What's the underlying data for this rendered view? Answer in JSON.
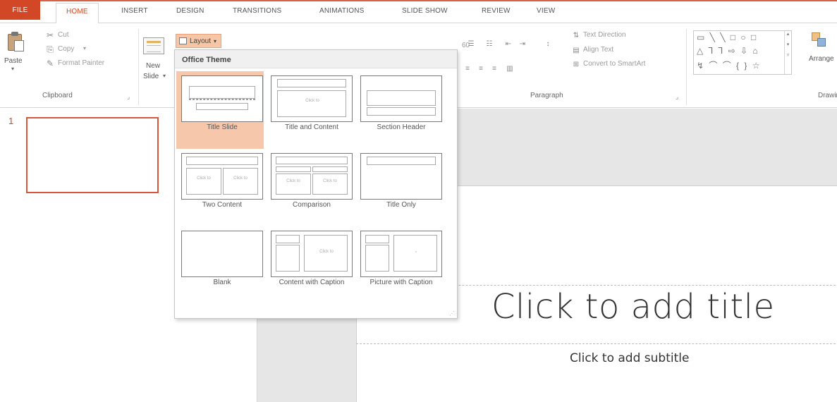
{
  "tabs": [
    {
      "label": "FILE"
    },
    {
      "label": "HOME"
    },
    {
      "label": "INSERT"
    },
    {
      "label": "DESIGN"
    },
    {
      "label": "TRANSITIONS"
    },
    {
      "label": "ANIMATIONS"
    },
    {
      "label": "SLIDE SHOW"
    },
    {
      "label": "REVIEW"
    },
    {
      "label": "VIEW"
    }
  ],
  "ribbon": {
    "clipboard": {
      "paste": "Paste",
      "cut": "Cut",
      "copy": "Copy",
      "format_painter": "Format Painter",
      "group_label": "Clipboard"
    },
    "slides": {
      "new_slide_line1": "New",
      "new_slide_line2": "Slide",
      "layout": "Layout"
    },
    "font": {
      "size": "60"
    },
    "paragraph": {
      "text_direction": "Text Direction",
      "align_text": "Align Text",
      "convert_smartart": "Convert to SmartArt",
      "group_label": "Paragraph"
    },
    "drawing": {
      "arrange": "Arrange",
      "group_label": "Drawin"
    }
  },
  "gallery": {
    "header": "Office Theme",
    "placeholder_hint": "Click to",
    "layouts": [
      {
        "label": "Title Slide"
      },
      {
        "label": "Title and Content"
      },
      {
        "label": "Section Header"
      },
      {
        "label": "Two Content"
      },
      {
        "label": "Comparison"
      },
      {
        "label": "Title Only"
      },
      {
        "label": "Blank"
      },
      {
        "label": "Content with Caption"
      },
      {
        "label": "Picture with Caption"
      }
    ]
  },
  "thumbnails": [
    {
      "number": "1"
    }
  ],
  "slide": {
    "title_placeholder": "Click to add title",
    "subtitle_placeholder": "Click to add subtitle"
  },
  "colors": {
    "accent": "#d24726",
    "selection": "#f7c7ab"
  }
}
